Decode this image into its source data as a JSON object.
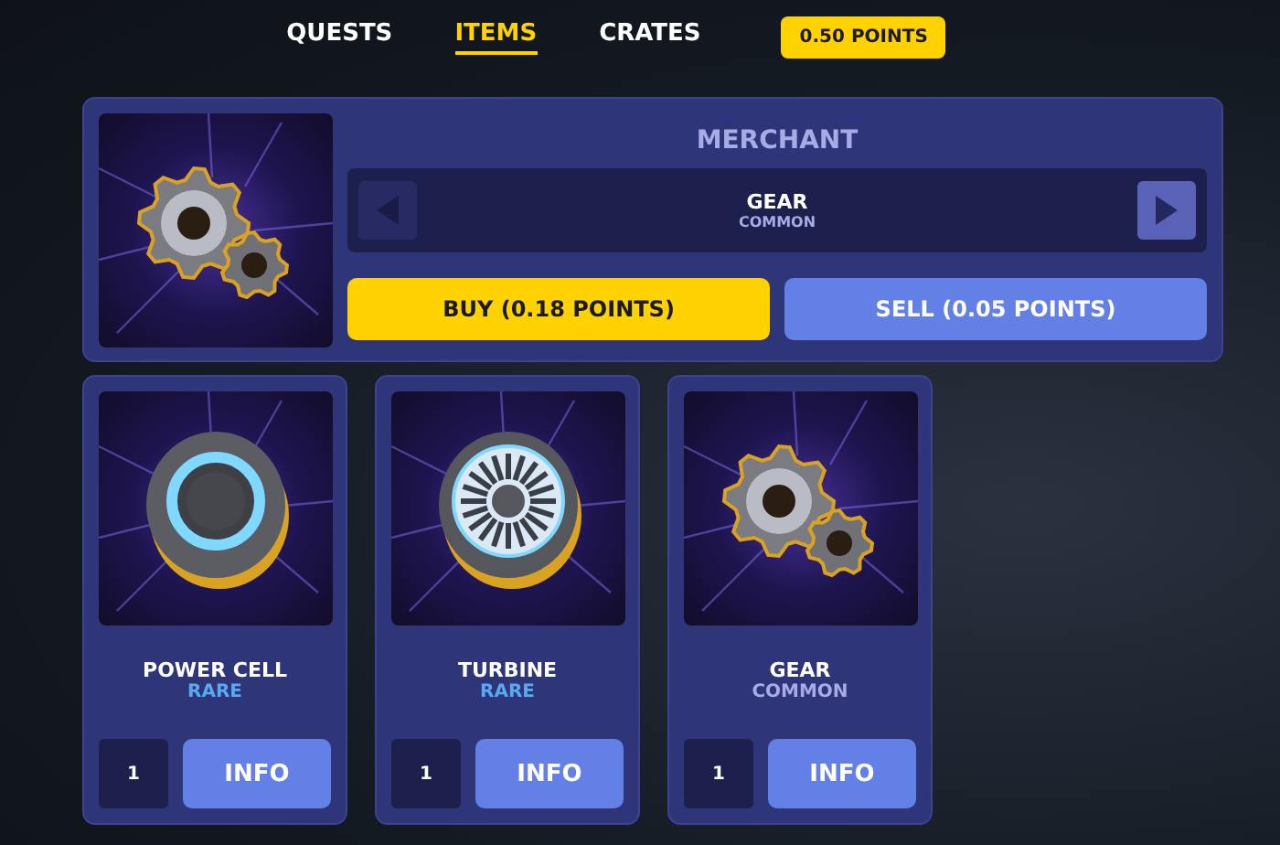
{
  "nav": {
    "tabs": [
      {
        "label": "QUESTS",
        "selected": false
      },
      {
        "label": "ITEMS",
        "selected": true
      },
      {
        "label": "CRATES",
        "selected": false
      }
    ],
    "points": "0.50 POINTS"
  },
  "merchant": {
    "title": "MERCHANT",
    "item": {
      "kind": "gear",
      "name": "GEAR",
      "rarity": "COMMON",
      "color": "#a7abe6"
    },
    "prev_button": {
      "disabled": true
    },
    "next_button": {
      "disabled": false
    },
    "buy_button": "BUY (0.18 POINTS)",
    "sell_button": "SELL (0.05 POINTS)"
  },
  "inventory": [
    {
      "kind": "power-cell",
      "name": "POWER CELL",
      "rarity": "RARE",
      "color": "#5aa9f0",
      "count": "1",
      "info_button": "INFO"
    },
    {
      "kind": "turbine",
      "name": "TURBINE",
      "rarity": "RARE",
      "color": "#5aa9f0",
      "count": "1",
      "info_button": "INFO"
    },
    {
      "kind": "gear",
      "name": "GEAR",
      "rarity": "COMMON",
      "color": "#a7abe6",
      "count": "1",
      "info_button": "INFO"
    }
  ]
}
